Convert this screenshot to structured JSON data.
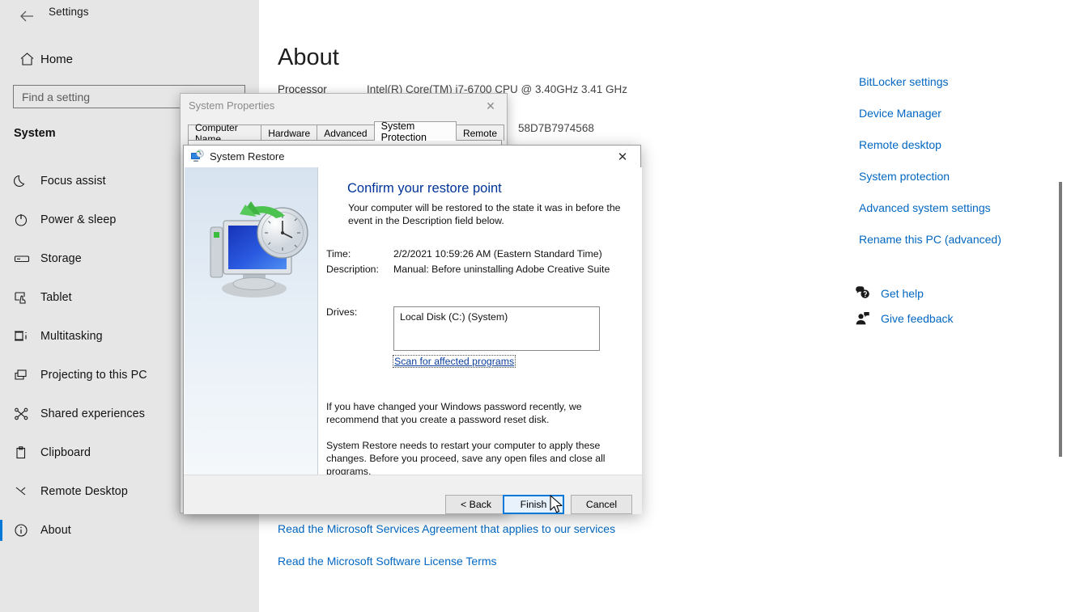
{
  "settings": {
    "window_title": "Settings",
    "back_icon": "back-arrow-icon",
    "home": {
      "label": "Home",
      "icon": "home-icon"
    },
    "search": {
      "placeholder": "Find a setting",
      "value": ""
    },
    "section_title": "System",
    "nav_items": [
      {
        "label": "Focus assist",
        "icon": "moon-icon",
        "selected": false
      },
      {
        "label": "Power & sleep",
        "icon": "power-icon",
        "selected": false
      },
      {
        "label": "Storage",
        "icon": "storage-icon",
        "selected": false
      },
      {
        "label": "Tablet",
        "icon": "tablet-icon",
        "selected": false
      },
      {
        "label": "Multitasking",
        "icon": "multitasking-icon",
        "selected": false
      },
      {
        "label": "Projecting to this PC",
        "icon": "projecting-icon",
        "selected": false
      },
      {
        "label": "Shared experiences",
        "icon": "shared-experiences-icon",
        "selected": false
      },
      {
        "label": "Clipboard",
        "icon": "clipboard-icon",
        "selected": false
      },
      {
        "label": "Remote Desktop",
        "icon": "remote-desktop-icon",
        "selected": false
      },
      {
        "label": "About",
        "icon": "info-icon",
        "selected": true
      }
    ],
    "window_controls": {
      "minimize": "—",
      "maximize": "☐",
      "close": "✕"
    }
  },
  "about": {
    "page_title": "About",
    "processor_label": "Processor",
    "processor_value": "Intel(R) Core(TM) i7-6700 CPU @ 3.40GHz   3.41 GHz",
    "device_id_fragment": "58D7B7974568",
    "bottom_links": [
      "Read the Microsoft Services Agreement that applies to our services",
      "Read the Microsoft Software License Terms"
    ],
    "related_links": [
      "BitLocker settings",
      "Device Manager",
      "Remote desktop",
      "System protection",
      "Advanced system settings",
      "Rename this PC (advanced)"
    ],
    "support_links": [
      {
        "label": "Get help",
        "icon": "get-help-icon"
      },
      {
        "label": "Give feedback",
        "icon": "give-feedback-icon"
      }
    ]
  },
  "system_properties": {
    "title": "System Properties",
    "close_glyph": "✕",
    "tabs": [
      {
        "label": "Computer Name",
        "active": false
      },
      {
        "label": "Hardware",
        "active": false
      },
      {
        "label": "Advanced",
        "active": false
      },
      {
        "label": "System Protection",
        "active": true
      },
      {
        "label": "Remote",
        "active": false
      }
    ]
  },
  "system_restore": {
    "title": "System Restore",
    "title_icon": "system-restore-icon",
    "close_glyph": "✕",
    "heading": "Confirm your restore point",
    "intro": "Your computer will be restored to the state it was in before the event in the Description field below.",
    "fields": [
      {
        "label": "Time:",
        "value": "2/2/2021 10:59:26 AM (Eastern Standard Time)"
      },
      {
        "label": "Description:",
        "value": "Manual: Before uninstalling Adobe Creative Suite"
      }
    ],
    "drives_label": "Drives:",
    "drives_items": [
      "Local Disk (C:) (System)"
    ],
    "scan_link": "Scan for affected programs",
    "paragraph_1": "If you have changed your Windows password recently, we recommend that you create a password reset disk.",
    "paragraph_2": "System Restore needs to restart your computer to apply these changes. Before you proceed, save any open files and close all programs.",
    "buttons": [
      {
        "label": "< Back",
        "default": false
      },
      {
        "label": "Finish",
        "default": true
      },
      {
        "label": "Cancel",
        "default": false
      }
    ]
  },
  "colors": {
    "accent": "#0078d7",
    "link": "#0267c1",
    "sidebar_bg": "#e6e6e6",
    "dialog_bg": "#f0f0f0",
    "wizard_heading": "#003399"
  }
}
